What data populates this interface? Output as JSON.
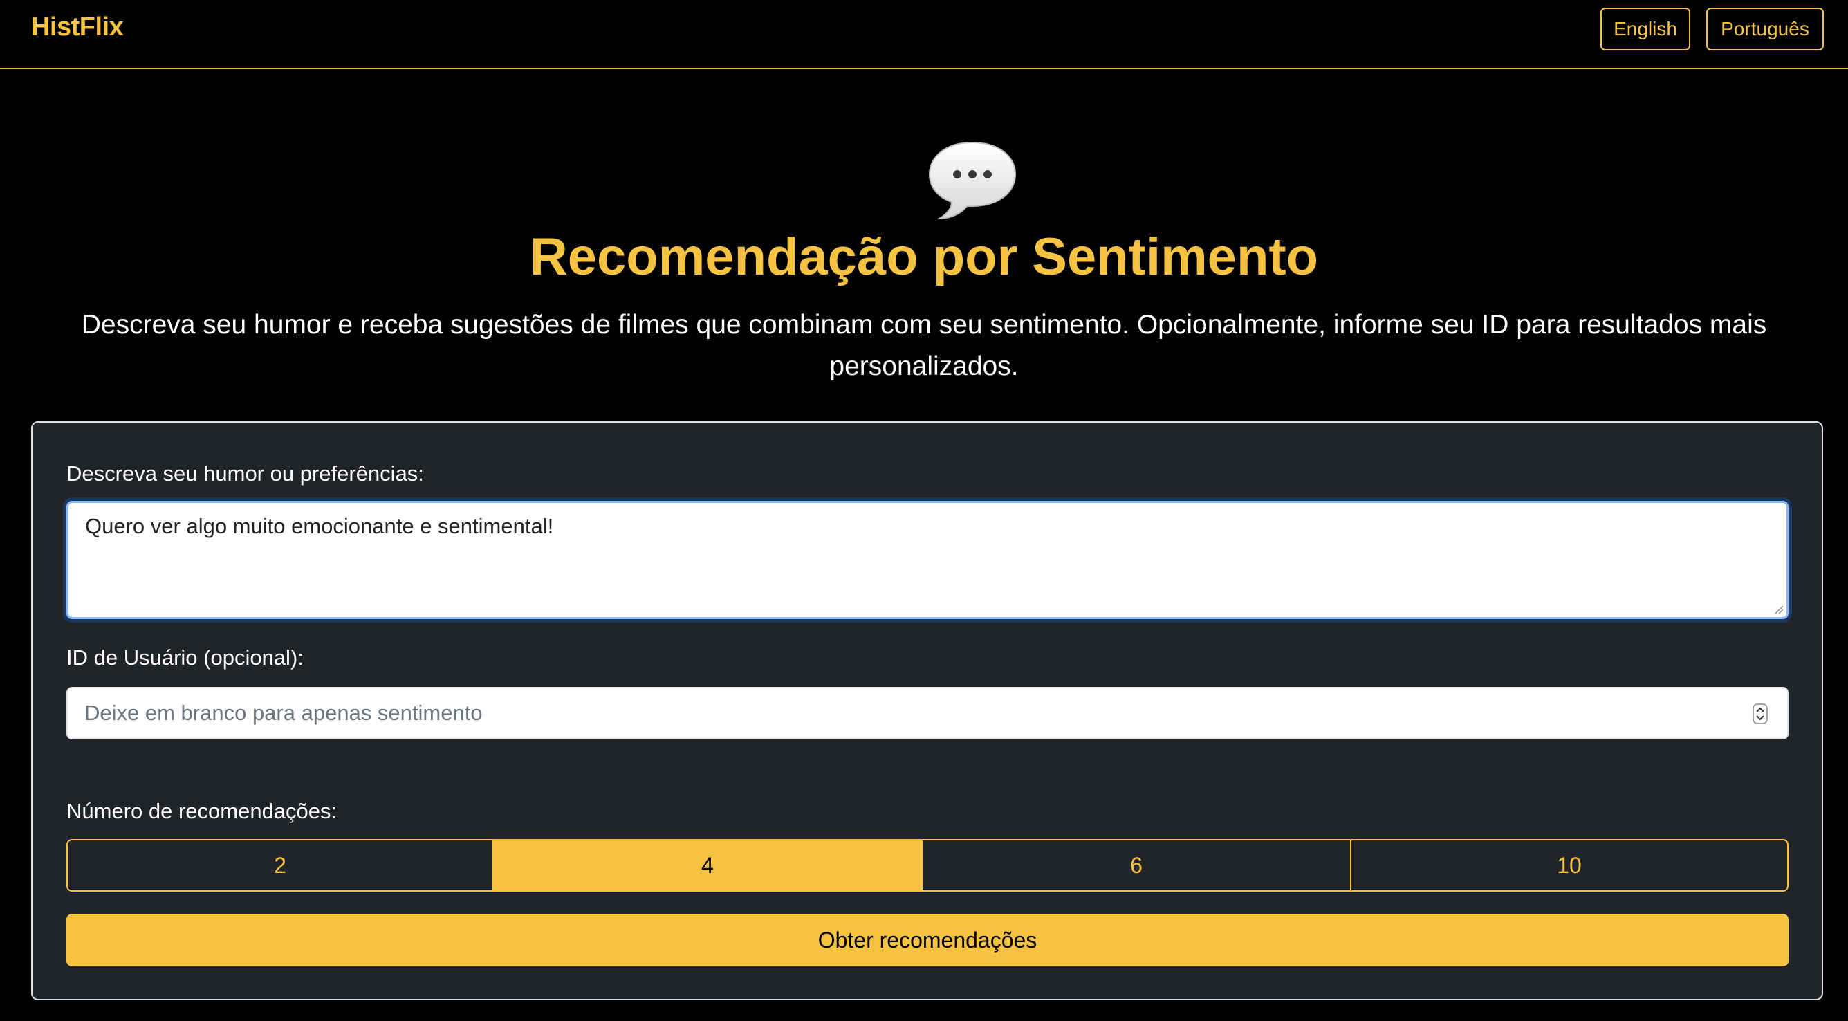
{
  "navbar": {
    "brand": "HistFlix",
    "languages": [
      {
        "label": "English"
      },
      {
        "label": "Português"
      }
    ]
  },
  "hero": {
    "icon": "speech-bubble-icon",
    "title": "Recomendação por Sentimento",
    "subtitle": "Descreva seu humor e receba sugestões de filmes que combinam com seu sentimento. Opcionalmente, informe seu ID para resultados mais personalizados."
  },
  "form": {
    "mood_label": "Descreva seu humor ou preferências:",
    "mood_value": "Quero ver algo muito emocionante e sentimental!",
    "user_label": "ID de Usuário (opcional):",
    "user_placeholder": "Deixe em branco para apenas sentimento",
    "num_label": "Número de recomendações:",
    "num_options": [
      "2",
      "4",
      "6",
      "10"
    ],
    "num_selected": "4",
    "submit_label": "Obter recomendações"
  },
  "colors": {
    "accent": "#f5c242",
    "background": "#000000",
    "card": "#212529"
  }
}
